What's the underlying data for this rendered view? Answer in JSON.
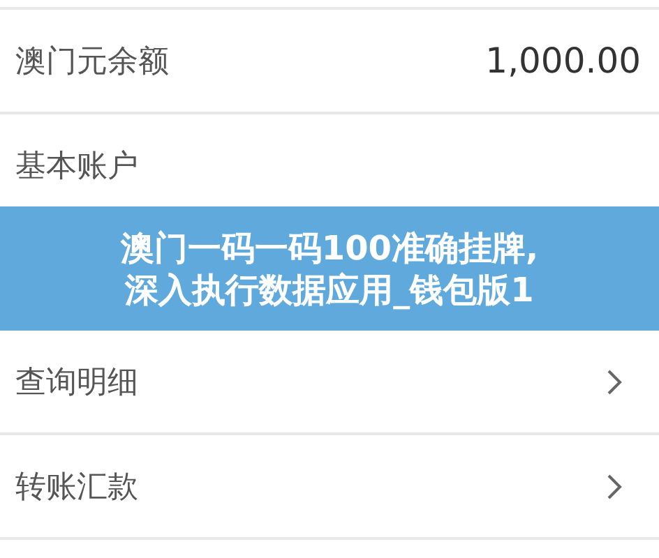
{
  "rows": [
    {
      "kind": "value",
      "label": "澳门元余额",
      "value": "1,000.00"
    },
    {
      "kind": "plain",
      "label": "基本账户"
    },
    {
      "kind": "banner"
    },
    {
      "kind": "link",
      "label": "查询明细"
    },
    {
      "kind": "link",
      "label": "转账汇款"
    }
  ],
  "banner": {
    "lines": [
      "澳门一码一码100准确挂牌,",
      "深入执行数据应用_钱包版1"
    ]
  }
}
